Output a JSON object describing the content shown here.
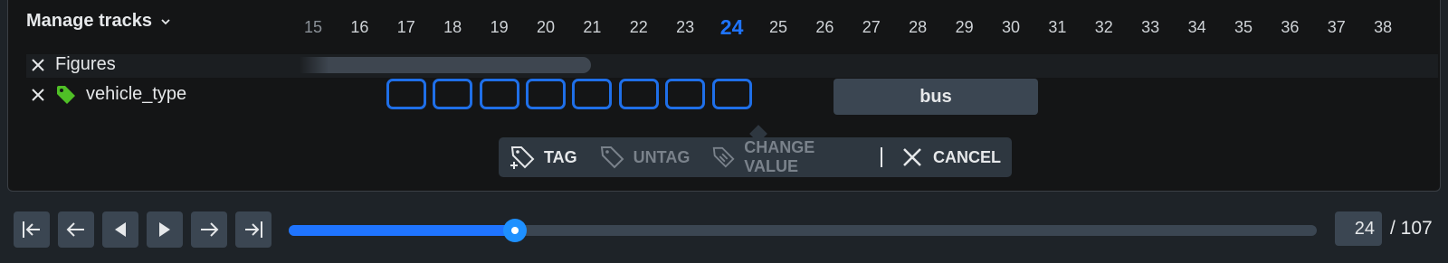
{
  "header": {
    "manage_tracks_label": "Manage tracks"
  },
  "timeline": {
    "frames": [
      "15",
      "16",
      "17",
      "18",
      "19",
      "20",
      "21",
      "22",
      "23",
      "24",
      "25",
      "26",
      "27",
      "28",
      "29",
      "30",
      "31",
      "32",
      "33",
      "34",
      "35",
      "36",
      "37",
      "38"
    ],
    "current_frame": "24"
  },
  "tracks": [
    {
      "label": "Figures",
      "icon": "close-icon"
    },
    {
      "label": "vehicle_type",
      "icon": "tag-icon",
      "icon_color": "#4fbf26"
    }
  ],
  "tag_value": "bus",
  "toolbar": {
    "tag": "TAG",
    "untag": "UNTAG",
    "change_value": "CHANGE VALUE",
    "cancel": "CANCEL"
  },
  "player": {
    "current": "24",
    "total": "/ 107",
    "progress_fraction": 0.225,
    "thumb_fraction": 0.22
  },
  "colors": {
    "accent": "#1f74ff",
    "panel_bg": "#141516",
    "page_bg": "#1e2328"
  }
}
